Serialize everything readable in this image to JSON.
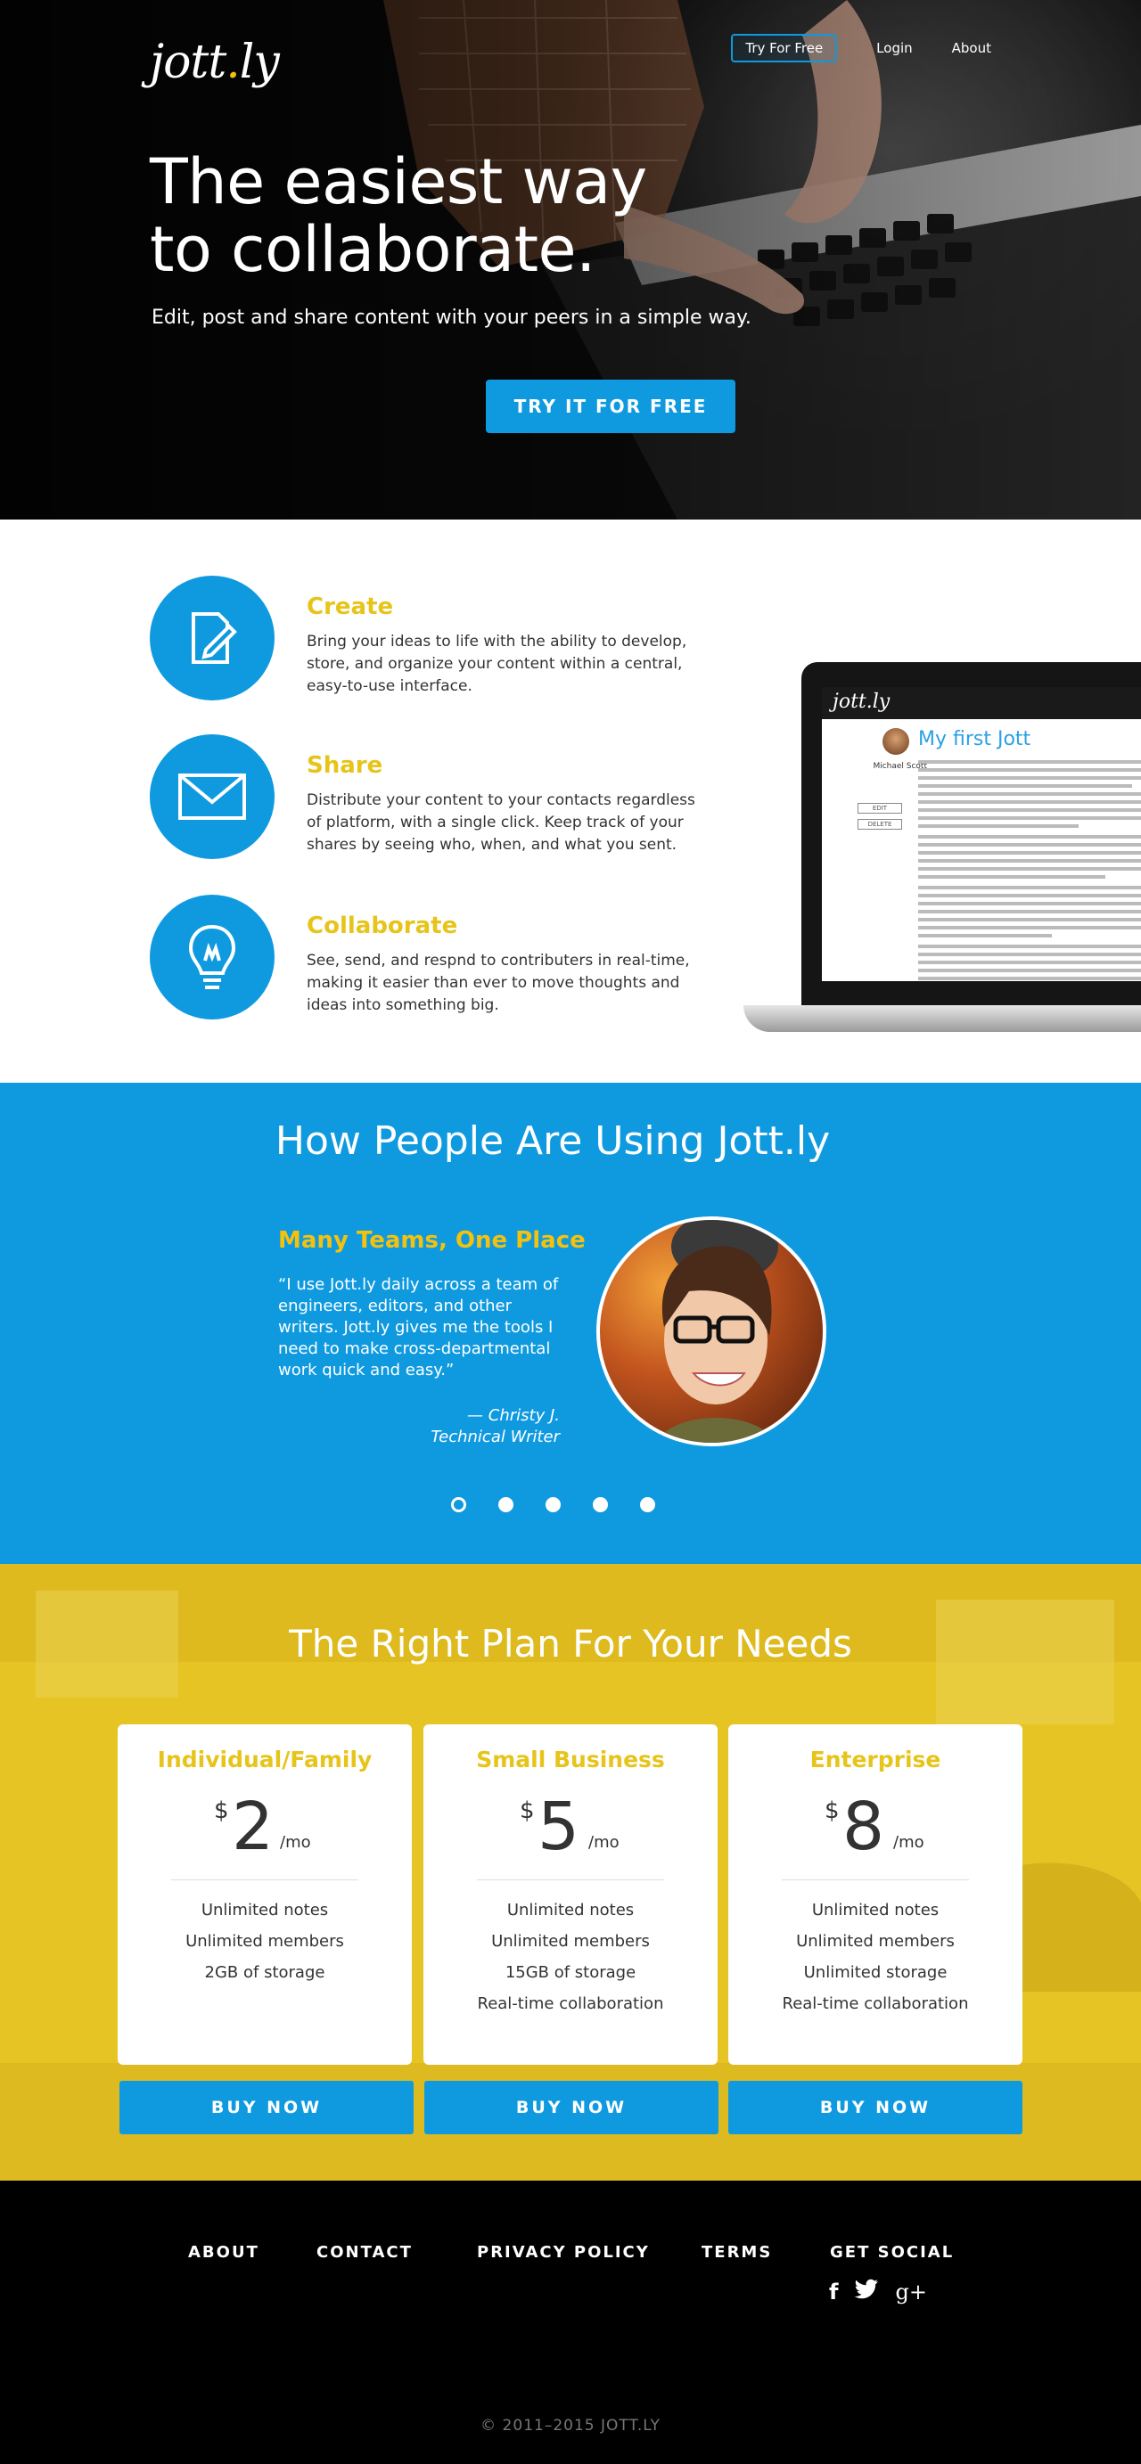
{
  "header": {
    "logo_text": "jott",
    "logo_dot": ".",
    "logo_suffix": "ly",
    "nav": {
      "cta_label": "Try For Free",
      "login_label": "Login",
      "about_label": "About"
    }
  },
  "hero": {
    "title_line1": "The easiest way",
    "title_line2": "to collaborate.",
    "subtitle": "Edit, post and share content with your peers in a simple way.",
    "cta_label": "TRY IT FOR FREE"
  },
  "features": {
    "items": [
      {
        "title": "Create",
        "text": "Bring your ideas to life with the ability to develop, store, and organize your content within a central, easy-to-use interface.",
        "icon": "edit-icon"
      },
      {
        "title": "Share",
        "text": "Distribute your content to your contacts regardless of platform, with a single click. Keep track of your shares by seeing who, when, and what you sent.",
        "icon": "envelope-icon"
      },
      {
        "title": "Collaborate",
        "text": "See, send, and respnd to contributers in real-time, making it easier than ever to move thoughts and ideas into something big.",
        "icon": "lightbulb-icon"
      }
    ],
    "mockup": {
      "app_logo": "jott.ly",
      "doc_title": "My first Jott",
      "user_name": "Michael Scott",
      "edit_label": "EDIT",
      "delete_label": "DELETE"
    }
  },
  "testimonials": {
    "heading": "How People Are Using Jott.ly",
    "quote_title": "Many Teams, One Place",
    "quote": "“I use Jott.ly daily across a team of engineers, editors, and other writers. Jott.ly gives me the tools I need to make cross-departmental work quick and easy.”",
    "author_name": "— Christy J.",
    "author_role": "Technical Writer",
    "slide_count": 5,
    "active_slide": 1
  },
  "pricing": {
    "heading": "The Right Plan For Your Needs",
    "plans": [
      {
        "name": "Individual/Family",
        "currency": "$",
        "amount": "2",
        "period": "/mo",
        "features": [
          "Unlimited notes",
          "Unlimited members",
          "2GB of storage"
        ],
        "button": "BUY NOW"
      },
      {
        "name": "Small Business",
        "currency": "$",
        "amount": "5",
        "period": "/mo",
        "features": [
          "Unlimited notes",
          "Unlimited members",
          "15GB of storage",
          "Real-time collaboration"
        ],
        "button": "BUY NOW"
      },
      {
        "name": "Enterprise",
        "currency": "$",
        "amount": "8",
        "period": "/mo",
        "features": [
          "Unlimited notes",
          "Unlimited members",
          "Unlimited storage",
          "Real-time collaboration"
        ],
        "button": "BUY NOW"
      }
    ]
  },
  "footer": {
    "links": [
      "ABOUT",
      "CONTACT",
      "PRIVACY POLICY",
      "TERMS",
      "GET SOCIAL"
    ],
    "social": {
      "facebook": "f",
      "twitter": "twitter-icon",
      "googleplus": "g+"
    },
    "copyright": "© 2011–2015 JOTT.LY"
  },
  "colors": {
    "accent_blue": "#0f9ae0",
    "accent_yellow": "#e7c41a",
    "footer_bg": "#000000"
  }
}
